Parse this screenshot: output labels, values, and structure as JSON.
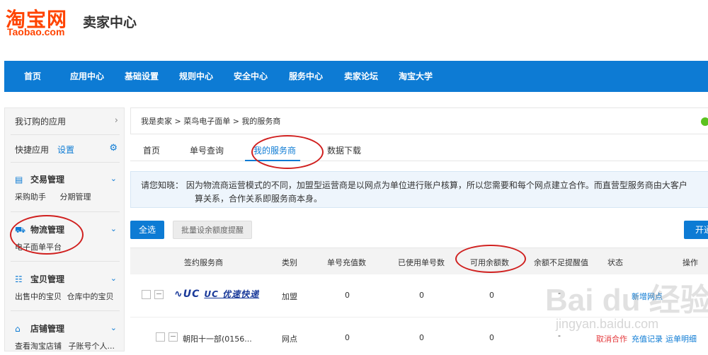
{
  "header": {
    "logo_cn": "淘宝网",
    "logo_en": "Taobao.com",
    "site_title": "卖家中心"
  },
  "nav": {
    "items": [
      "首页",
      "应用中心",
      "基础设置",
      "规则中心",
      "安全中心",
      "服务中心",
      "卖家论坛",
      "淘宝大学"
    ]
  },
  "sidebar": {
    "subscribed_apps": "我订购的应用",
    "quick_apps": "快捷应用",
    "settings_link": "设置",
    "groups": [
      {
        "title": "交易管理",
        "subs": [
          "采购助手",
          "分期管理"
        ]
      },
      {
        "title": "物流管理",
        "subs": [
          "电子面单平台"
        ]
      },
      {
        "title": "宝贝管理",
        "subs": [
          "出售中的宝贝",
          "仓库中的宝贝"
        ]
      },
      {
        "title": "店铺管理",
        "subs": [
          "查看淘宝店铺",
          "子账号个人..."
        ]
      }
    ]
  },
  "breadcrumb": "我是卖家 > 菜鸟电子面单 > 我的服务商",
  "tabs": [
    "首页",
    "单号查询",
    "我的服务商",
    "数据下载"
  ],
  "notice": {
    "line1": "请您知晓：  因为物流商运营模式的不同，加盟型运营商是以网点为单位进行账户核算，所以您需要和每个网点建立合作。而直营型服务商由大客户",
    "line2": "算关系，合作关系即服务商本身。"
  },
  "buttons": {
    "select_all": "全选",
    "batch_threshold": "批量设余额度提醒",
    "open": "开通"
  },
  "table": {
    "headers": [
      "签约服务商",
      "类别",
      "单号充值数",
      "已使用单号数",
      "可用余额数",
      "余额不足提醒值",
      "状态",
      "操作"
    ],
    "rows": [
      {
        "provider_logo": "UC 优速快递",
        "category": "加盟",
        "recharged": "0",
        "used": "0",
        "available": "0",
        "threshold": "-",
        "status": "",
        "actions": [
          "新增网点"
        ]
      },
      {
        "provider": "朝阳十一部(0156...",
        "category": "网点",
        "recharged": "0",
        "used": "0",
        "available": "0",
        "threshold": "-",
        "status": "",
        "actions": [
          "取消合作",
          "充值记录",
          "运单明细"
        ]
      }
    ]
  },
  "watermark": {
    "main": "Bai du 经验",
    "sub": "jingyan.baidu.com"
  },
  "colors": {
    "brand_orange": "#ff4400",
    "nav_blue": "#0d7bd4",
    "annotation_red": "#d0201f",
    "link_red": "#e4393c"
  }
}
